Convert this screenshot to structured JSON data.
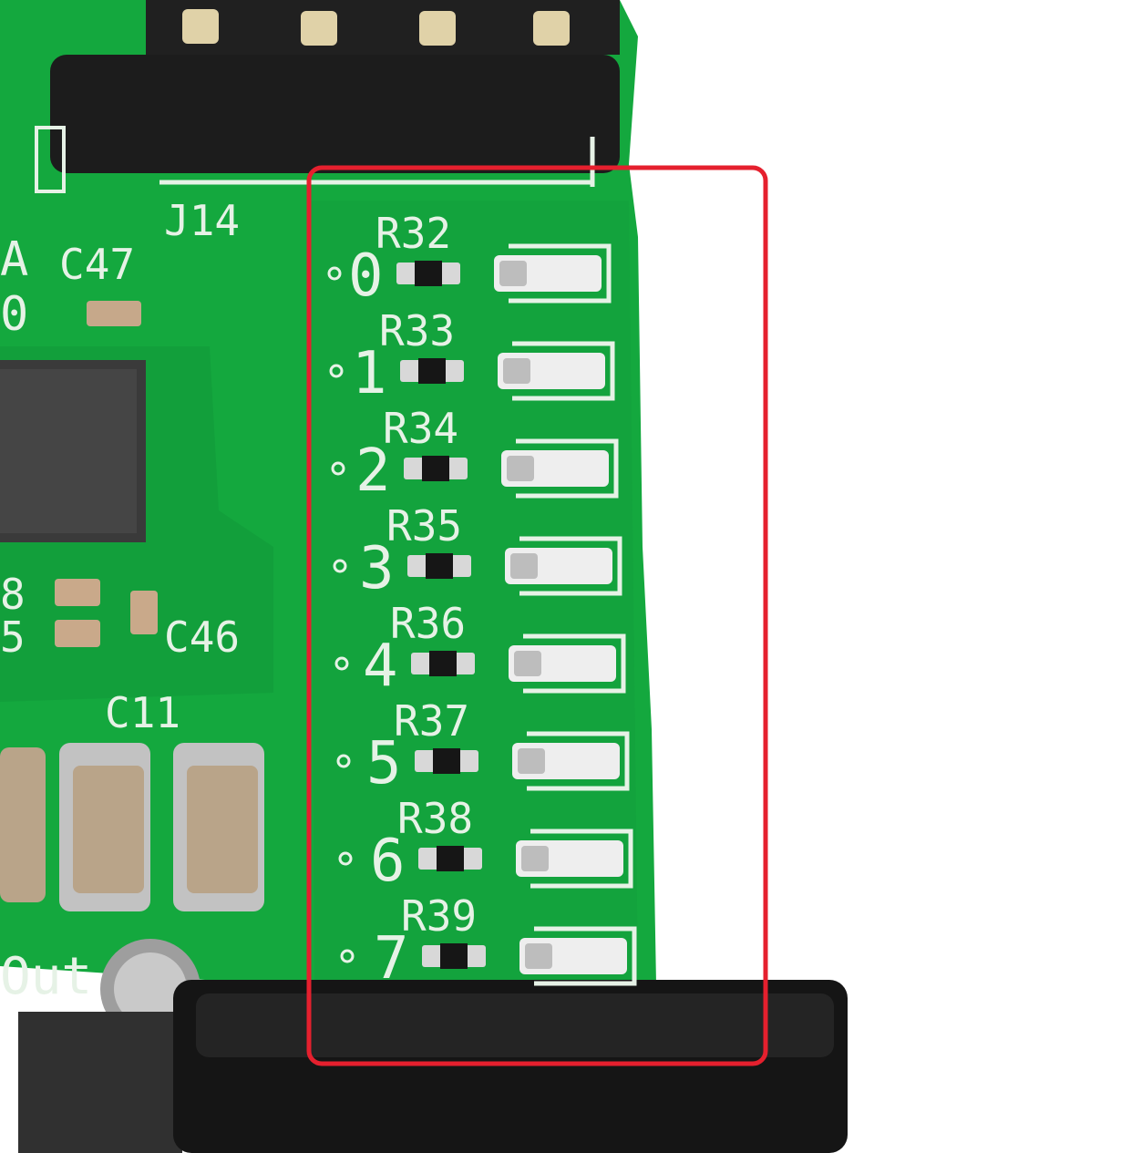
{
  "photo": {
    "subject": "green printed circuit board with eight LEDs and series resistors",
    "colors": {
      "board": "#14a83e",
      "board_dark": "#0e8a31",
      "silkscreen": "#e6f2e6",
      "highlight_box": "#e5202e",
      "jack": "#151515",
      "header": "#1c1c1c",
      "capacitor": "#b9a489",
      "led": "#eeeeee"
    }
  },
  "labels": {
    "header_ref": "J14",
    "cap_c47": "C47",
    "cap_c46": "C46",
    "cap_c11": "C11",
    "edge_left_a": "A",
    "edge_left_0": "0",
    "edge_left_8": "8",
    "edge_left_5": "5",
    "edge_out": "Out"
  },
  "leds": [
    {
      "index": "0",
      "resistor": "R32"
    },
    {
      "index": "1",
      "resistor": "R33"
    },
    {
      "index": "2",
      "resistor": "R34"
    },
    {
      "index": "3",
      "resistor": "R35"
    },
    {
      "index": "4",
      "resistor": "R36"
    },
    {
      "index": "5",
      "resistor": "R37"
    },
    {
      "index": "6",
      "resistor": "R38"
    },
    {
      "index": "7",
      "resistor": "R39"
    }
  ]
}
